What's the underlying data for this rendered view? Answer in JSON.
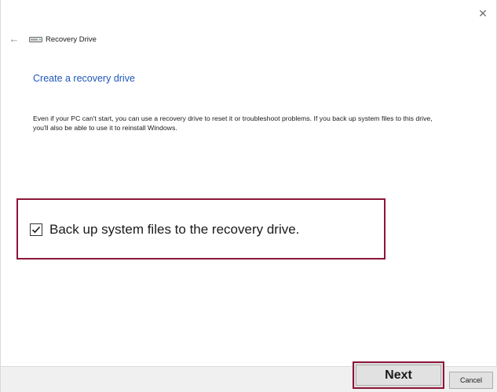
{
  "window": {
    "title": "Recovery Drive",
    "close_glyph": "✕",
    "back_glyph": "←",
    "icons": {
      "back": "back-arrow-icon",
      "drive": "drive-icon",
      "close": "close-icon",
      "checkmark": "checkmark-icon"
    }
  },
  "main": {
    "heading": "Create a recovery drive",
    "description": "Even if your PC can't start, you can use a recovery drive to reset it or troubleshoot problems. If you back up system files to this drive, you'll also be able to use it to reinstall Windows.",
    "backup_checkbox": {
      "label": "Back up system files to the recovery drive.",
      "checked": true
    }
  },
  "footer": {
    "next_label": "Next",
    "cancel_label": "Cancel"
  },
  "colors": {
    "heading": "#1e57b9",
    "highlight": "#8c1538",
    "footer_bg": "#f0f0f0",
    "button_bg": "#e1e1e1"
  }
}
